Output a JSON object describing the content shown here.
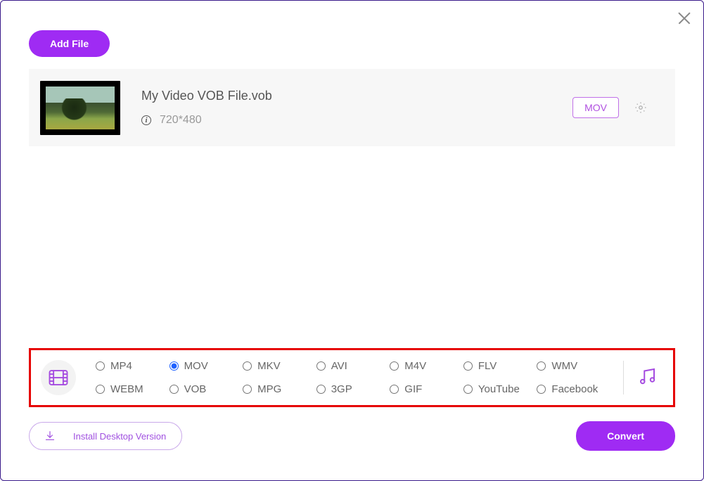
{
  "colors": {
    "accent": "#9f2bf3",
    "highlight_border": "#e60000"
  },
  "header": {
    "add_file_label": "Add File"
  },
  "file_item": {
    "name": "My Video VOB File.vob",
    "dimensions": "720*480",
    "output_format": "MOV"
  },
  "format_bar": {
    "selected": "MOV",
    "options_row1": [
      "MP4",
      "MOV",
      "MKV",
      "AVI",
      "M4V",
      "FLV",
      "WMV"
    ],
    "options_row2": [
      "WEBM",
      "VOB",
      "MPG",
      "3GP",
      "GIF",
      "YouTube",
      "Facebook"
    ]
  },
  "footer": {
    "install_label": "Install Desktop Version",
    "convert_label": "Convert"
  }
}
